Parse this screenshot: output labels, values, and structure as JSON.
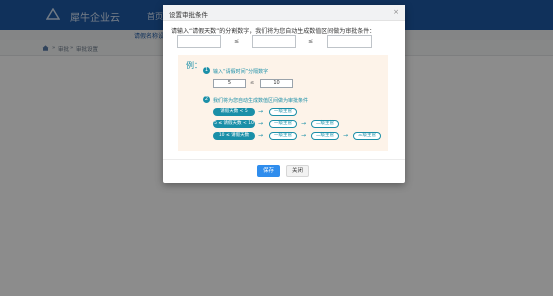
{
  "app": {
    "brand": "犀牛企业云",
    "nav_item": "首页",
    "subnav_item": "请假名称设置",
    "breadcrumb": [
      "审批",
      "审批设置"
    ]
  },
  "dialog": {
    "title": "设置审批条件",
    "close_glyph": "×",
    "instruction": "请输入“请假天数”的分割数字，我们将为您自动生成数值区间做为审批条件：",
    "inputs": [
      "",
      "",
      ""
    ],
    "le_symbol": "≤",
    "example": {
      "label": "例：",
      "step1_num": "1",
      "step1_text": "输入“请假时间”分隔数字",
      "sample_values": [
        "5",
        "10"
      ],
      "step2_num": "2",
      "step2_text": "我们将为您自动生成数值区间做为审批条件",
      "rows": [
        {
          "condition": "请假天数 < 5",
          "levels": [
            "一级主管"
          ]
        },
        {
          "condition": "5 ≤ 请假天数 < 10",
          "levels": [
            "一级主管",
            "二级主管"
          ]
        },
        {
          "condition": "10 ≤ 请假天数",
          "levels": [
            "一级主管",
            "二级主管",
            "三级主管"
          ]
        }
      ]
    },
    "buttons": {
      "save": "保存",
      "close": "关闭"
    }
  },
  "colors": {
    "topbar": "#1e5aa6",
    "accent": "#1a8fa8",
    "primary_button": "#2f8ded",
    "example_bg": "#fdf3e9"
  }
}
